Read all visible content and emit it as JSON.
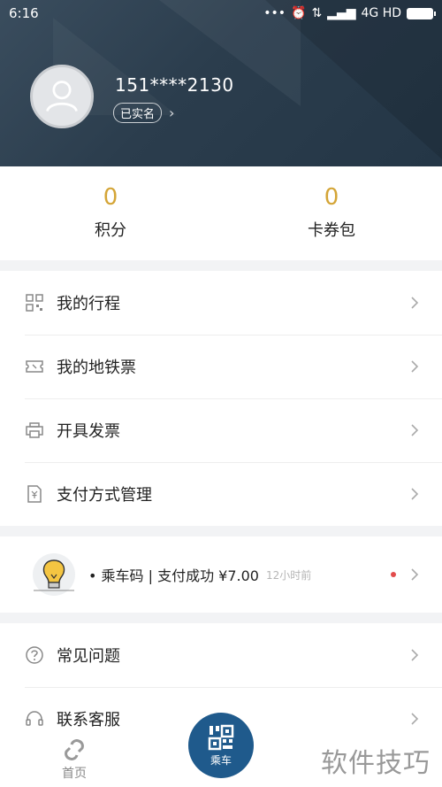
{
  "status_bar": {
    "time": "6:16",
    "dots": "•••",
    "network": "4G HD"
  },
  "profile": {
    "phone": "151****2130",
    "verified_label": "已实名"
  },
  "stats": [
    {
      "value": "0",
      "label": "积分"
    },
    {
      "value": "0",
      "label": "卡券包"
    }
  ],
  "menu1": [
    {
      "label": "我的行程",
      "icon": "trip-icon"
    },
    {
      "label": "我的地铁票",
      "icon": "ticket-icon"
    },
    {
      "label": "开具发票",
      "icon": "printer-icon"
    },
    {
      "label": "支付方式管理",
      "icon": "yen-doc-icon"
    }
  ],
  "notice": {
    "text": "• 乘车码 | 支付成功 ¥7.00",
    "time": "12小时前"
  },
  "menu2": [
    {
      "label": "常见问题",
      "icon": "question-icon"
    },
    {
      "label": "联系客服",
      "icon": "headset-icon"
    }
  ],
  "tabbar": {
    "home_label": "首页",
    "ride_label": "乘车"
  },
  "watermark": "软件技巧",
  "colors": {
    "header": "#2b3d4d",
    "stat_value": "#d4a537",
    "ride_button": "#1f5a8c",
    "red_dot": "#e24b4b"
  }
}
